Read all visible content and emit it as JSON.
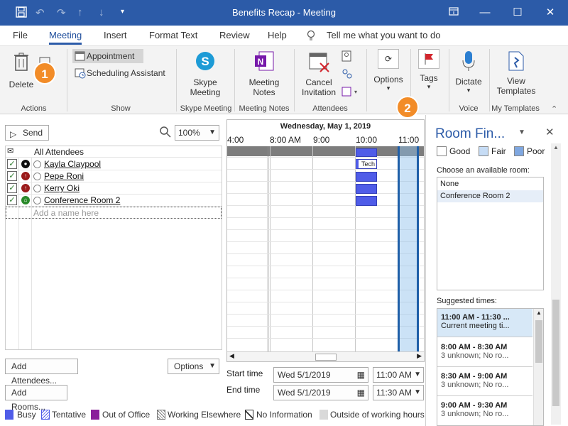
{
  "window": {
    "title": "Benefits Recap  -  Meeting"
  },
  "menu": [
    "File",
    "Meeting",
    "Insert",
    "Format Text",
    "Review",
    "Help"
  ],
  "tell_me": "Tell me what you want to do",
  "ribbon": {
    "delete": "Delete",
    "appointment": "Appointment",
    "scheduling_assistant": "Scheduling Assistant",
    "skype1": "Skype",
    "skype2": "Meeting",
    "notes1": "Meeting",
    "notes2": "Notes",
    "cancel1": "Cancel",
    "cancel2": "Invitation",
    "options": "Options",
    "tags": "Tags",
    "dictate": "Dictate",
    "templates1": "View",
    "templates2": "Templates",
    "groups": [
      "Actions",
      "Show",
      "Skype Meeting",
      "Meeting Notes",
      "Attendees",
      "Voice",
      "My Templates"
    ]
  },
  "callouts": [
    "1",
    "2"
  ],
  "attendees": {
    "send": "Send",
    "zoom": "100%",
    "header": "All Attendees",
    "rows": [
      "Kayla Claypool",
      "Pepe Roni",
      "Kerry Oki",
      "Conference Room 2"
    ],
    "placeholder": "Add a name here",
    "add_attendees": "Add Attendees...",
    "options": "Options",
    "add_rooms": "Add Rooms..."
  },
  "schedule": {
    "date": "Wednesday, May 1, 2019",
    "times": [
      "4:00",
      "8:00 AM",
      "9:00",
      "10:00",
      "11:00"
    ],
    "event_label": "Tech"
  },
  "times": {
    "start_label": "Start time",
    "end_label": "End time",
    "start_date": "Wed 5/1/2019",
    "start_time": "11:00 AM",
    "end_date": "Wed 5/1/2019",
    "end_time": "11:30 AM"
  },
  "room_finder": {
    "title": "Room Fin...",
    "good": "Good",
    "fair": "Fair",
    "poor": "Poor",
    "choose": "Choose an available room:",
    "rooms": [
      "None",
      "Conference Room 2"
    ],
    "suggested": "Suggested times:",
    "slots": [
      {
        "time": "11:00 AM - 11:30 ...",
        "desc": "Current meeting ti..."
      },
      {
        "time": "8:00 AM - 8:30 AM",
        "desc": "3 unknown; No ro..."
      },
      {
        "time": "8:30 AM - 9:00 AM",
        "desc": "3 unknown; No ro..."
      },
      {
        "time": "9:00 AM - 9:30 AM",
        "desc": "3 unknown; No ro..."
      }
    ]
  },
  "legend": [
    "Busy",
    "Tentative",
    "Out of Office",
    "Working Elsewhere",
    "No Information",
    "Outside of working hours"
  ],
  "colors": {
    "titlebar": "#2c5ba8",
    "busy": "#4f5ce8",
    "oof": "#8a1f9a",
    "callout": "#f28c28",
    "fair": "#c6dcf5",
    "poor": "#7fa7e0"
  }
}
